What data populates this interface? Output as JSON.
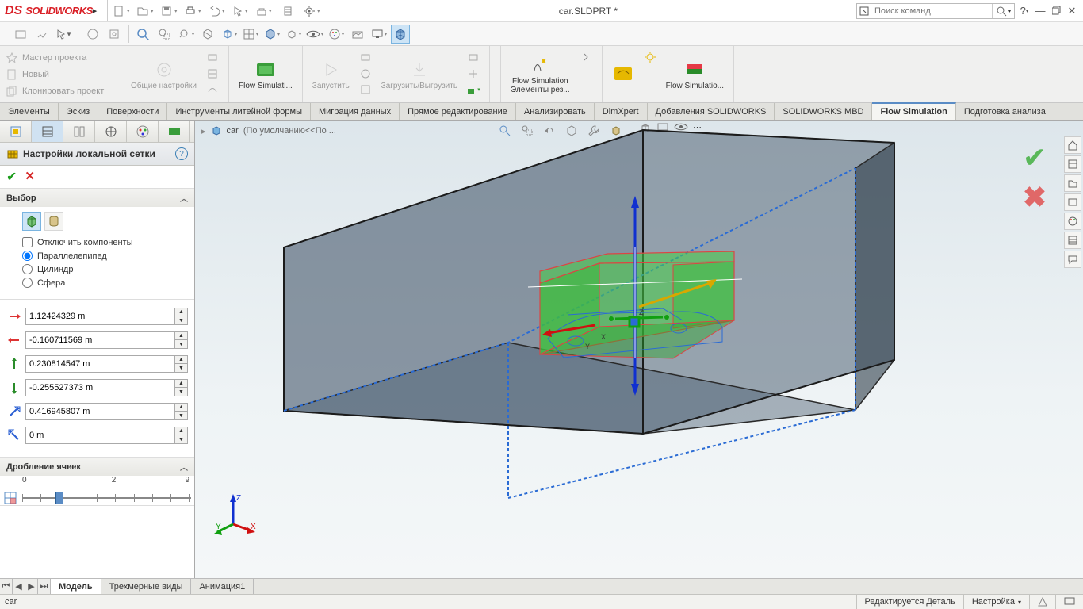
{
  "app": {
    "title": "car.SLDPRT *",
    "search_placeholder": "Поиск команд",
    "logo_text": "SOLIDWORKS"
  },
  "menu_icons": [
    "new-doc",
    "open-doc",
    "save-doc",
    "print",
    "undo",
    "select",
    "rebuild",
    "sheet",
    "settings"
  ],
  "ribbon_left": {
    "master": "Мастер проекта",
    "new": "Новый",
    "clone": "Клонировать проект"
  },
  "ribbon_cells": {
    "general_settings": "Общие настройки",
    "flow_sim": "Flow Simulati...",
    "run": "Запустить",
    "load_unload": "Загрузить/Выгрузить",
    "flow_sim_elements_1": "Flow Simulation",
    "flow_sim_elements_2": "Элементы рез...",
    "flow_sim2": "Flow Simulatio..."
  },
  "tabs": [
    "Элементы",
    "Эскиз",
    "Поверхности",
    "Инструменты литейной формы",
    "Миграция данных",
    "Прямое редактирование",
    "Анализировать",
    "DimXpert",
    "Добавления SOLIDWORKS",
    "SOLIDWORKS MBD",
    "Flow Simulation",
    "Подготовка анализа"
  ],
  "active_tab_index": 10,
  "prop_panel": {
    "title": "Настройки локальной сетки",
    "section_select": "Выбор",
    "chk_disable": "Отключить компоненты",
    "rbo_box": "Параллелепипед",
    "rbo_cyl": "Цилиндр",
    "rbo_sph": "Сфера",
    "vals": {
      "x_max": "1.12424329 m",
      "x_min": "-0.160711569 m",
      "y_max": "0.230814547 m",
      "y_min": "-0.255527373 m",
      "z_max": "0.416945807 m",
      "z_min": "0 m"
    },
    "section_refine": "Дробление ячеек",
    "slider_min": "0",
    "slider_max": "9",
    "slider_val": 2
  },
  "viewport_breadcrumb": {
    "part": "car",
    "config": "(По умолчанию<<По ..."
  },
  "view_tabs": [
    "Модель",
    "Трехмерные виды",
    "Анимация1"
  ],
  "active_view_tab": 0,
  "status": {
    "left": "car",
    "right1": "Редактируется Деталь",
    "right2": "Настройка"
  },
  "triad": {
    "x": "X",
    "y": "Y",
    "z": "Z"
  }
}
